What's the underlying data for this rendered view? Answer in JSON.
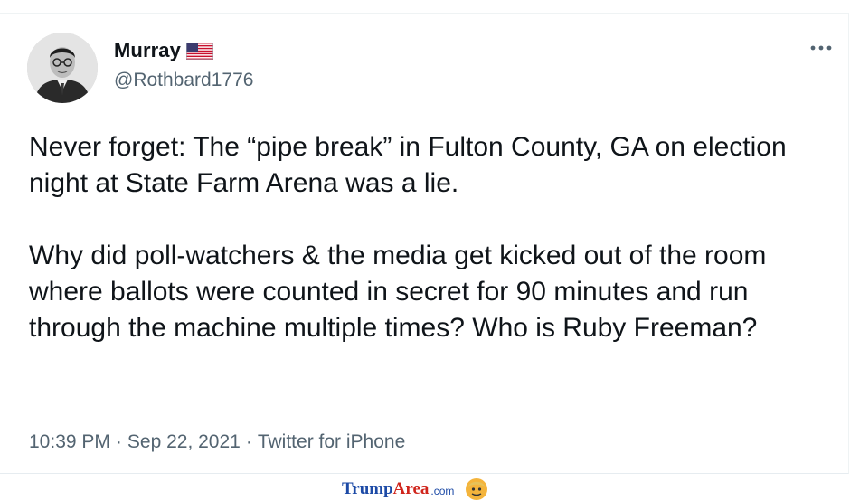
{
  "user": {
    "display_name": "Murray",
    "handle": "@Rothbard1776",
    "badge_icon": "us-flag-icon"
  },
  "tweet": {
    "text": "Never forget: The “pipe break” in Fulton County, GA on election night at State Farm Arena was a lie.\n\nWhy did poll-watchers & the media get kicked out of the room where ballots were counted in secret for 90 minutes and run through the machine multiple times? Who is Ruby Freeman?",
    "time": "10:39 PM",
    "date": "Sep 22, 2021",
    "source": "Twitter for iPhone",
    "separator": "·"
  },
  "watermark": {
    "part1": "Trump",
    "part2": "Area",
    "part3": ".com"
  },
  "colors": {
    "text_primary": "#0f1419",
    "text_secondary": "#536471",
    "watermark_blue": "#1c4aa6",
    "watermark_red": "#d0251c"
  }
}
